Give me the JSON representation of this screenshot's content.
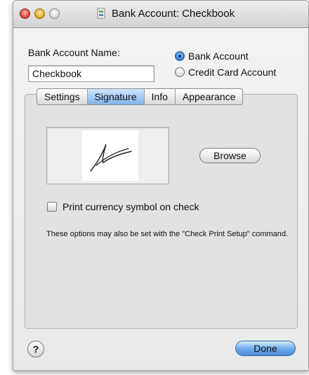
{
  "window": {
    "title": "Bank Account: Checkbook"
  },
  "form": {
    "name_label": "Bank Account Name:",
    "name_value": "Checkbook",
    "account_types": [
      {
        "label": "Bank Account",
        "selected": true
      },
      {
        "label": "Credit Card Account",
        "selected": false
      }
    ]
  },
  "tabs": [
    {
      "label": "Settings",
      "selected": false
    },
    {
      "label": "Signature",
      "selected": true
    },
    {
      "label": "Info",
      "selected": false
    },
    {
      "label": "Appearance",
      "selected": false
    }
  ],
  "signature": {
    "browse_label": "Browse",
    "print_currency_label": "Print currency symbol on check",
    "print_currency_checked": false,
    "note": "These options may also be set with the \"Check Print Setup\" command."
  },
  "footer": {
    "help_label": "?",
    "done_label": "Done"
  },
  "colors": {
    "accent": "#4a8cd8",
    "window_bg": "#e9e9e9"
  }
}
